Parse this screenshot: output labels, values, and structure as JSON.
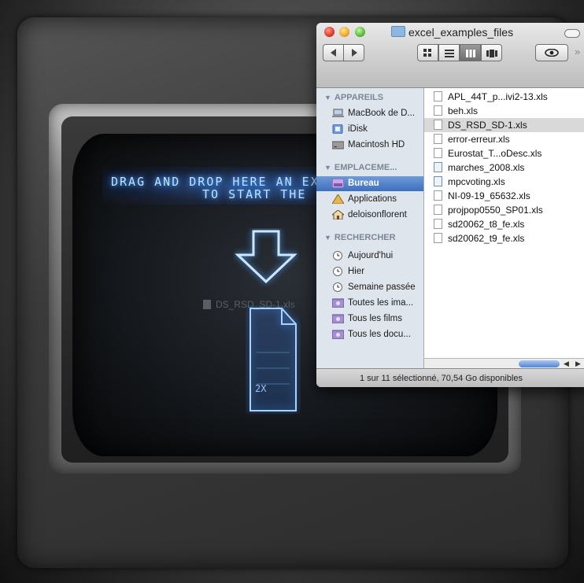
{
  "window": {
    "title": "excel_examples_files",
    "status": "1 sur 11 sélectionné, 70,54 Go disponibles"
  },
  "toolbar": {
    "view_modes": [
      "icon-view",
      "list-view",
      "column-view",
      "coverflow-view"
    ],
    "active_view": "column-view",
    "quicklook_icon": "eye-icon"
  },
  "sidebar": {
    "sections": [
      {
        "label": "APPAREILS",
        "items": [
          {
            "label": "MacBook de D...",
            "icon": "laptop-icon"
          },
          {
            "label": "iDisk",
            "icon": "idisk-icon"
          },
          {
            "label": "Macintosh HD",
            "icon": "hard-drive-icon"
          }
        ]
      },
      {
        "label": "EMPLACEME...",
        "items": [
          {
            "label": "Bureau",
            "icon": "desktop-icon",
            "selected": true
          },
          {
            "label": "Applications",
            "icon": "applications-icon"
          },
          {
            "label": "deloisonflorent",
            "icon": "home-icon"
          }
        ]
      },
      {
        "label": "RECHERCHER",
        "items": [
          {
            "label": "Aujourd'hui",
            "icon": "clock-icon"
          },
          {
            "label": "Hier",
            "icon": "clock-icon"
          },
          {
            "label": "Semaine passée",
            "icon": "clock-icon"
          },
          {
            "label": "Toutes les ima...",
            "icon": "smart-folder-icon"
          },
          {
            "label": "Tous les films",
            "icon": "smart-folder-icon"
          },
          {
            "label": "Tous les docu...",
            "icon": "smart-folder-icon"
          }
        ]
      }
    ]
  },
  "files": [
    {
      "name": "APL_44T_p...ivi2-13.xls",
      "selected": false
    },
    {
      "name": "beh.xls",
      "selected": false
    },
    {
      "name": "DS_RSD_SD-1.xls",
      "selected": true
    },
    {
      "name": "error-erreur.xls",
      "selected": false
    },
    {
      "name": "Eurostat_T...oDesc.xls",
      "selected": false
    },
    {
      "name": "marches_2008.xls",
      "selected": false
    },
    {
      "name": "mpcvoting.xls",
      "selected": false
    },
    {
      "name": "NI-09-19_65632.xls",
      "selected": false
    },
    {
      "name": "projpop0550_SP01.xls",
      "selected": false
    },
    {
      "name": "sd20062_t8_fe.xls",
      "selected": false
    },
    {
      "name": "sd20062_t9_fe.xls",
      "selected": false
    }
  ],
  "app_screen": {
    "drop_line1": "DRAG AND DROP HERE AN EX",
    "drop_line2": "TO START THE",
    "dragged_file": "DS_RSD_SD-1.xls",
    "doc_label": "2X",
    "accent": "#4aa3ff"
  }
}
